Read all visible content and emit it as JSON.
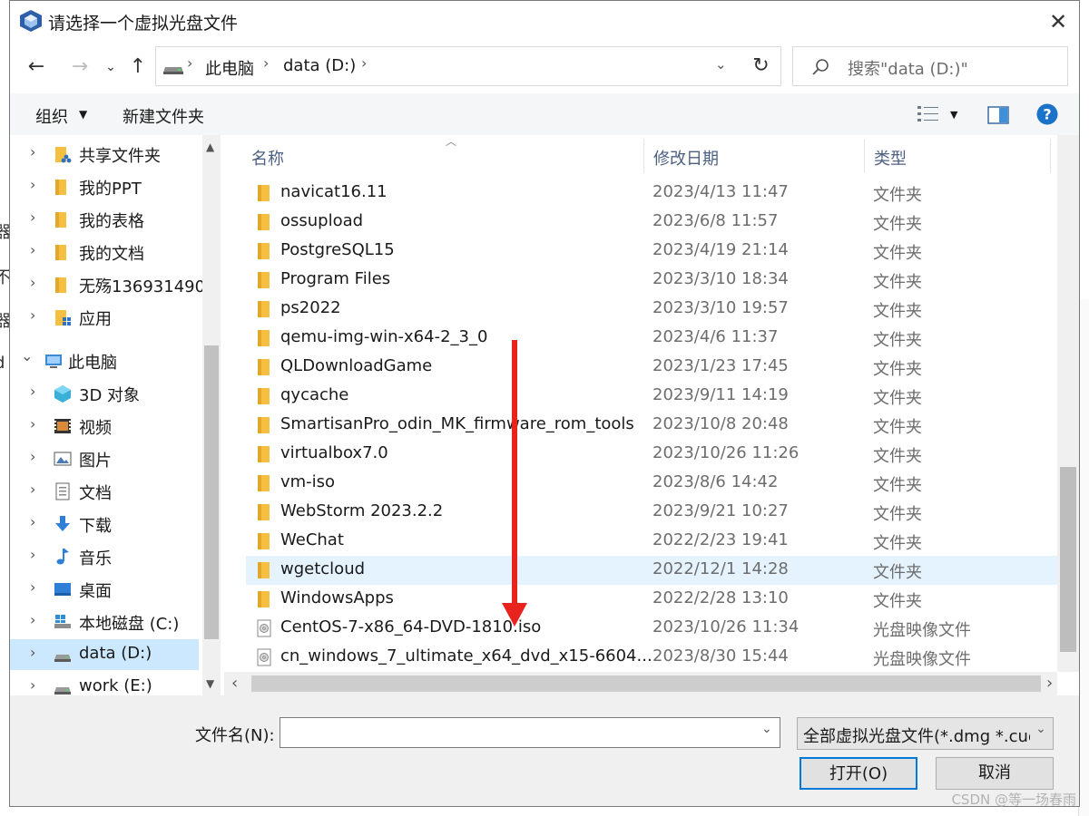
{
  "title": "请选择一个虚拟光盘文件",
  "breadcrumb": [
    "此电脑",
    "data (D:)"
  ],
  "search": {
    "placeholder": "搜索\"data (D:)\""
  },
  "toolbar": {
    "organize": "组织",
    "new_folder": "新建文件夹"
  },
  "nav_tree": [
    {
      "label": "共享文件夹",
      "icon": "shared-folder-icon"
    },
    {
      "label": "我的PPT",
      "icon": "folder-icon"
    },
    {
      "label": "我的表格",
      "icon": "folder-icon"
    },
    {
      "label": "我的文档",
      "icon": "folder-icon"
    },
    {
      "label": "无殇136931490",
      "icon": "folder-icon"
    },
    {
      "label": "应用",
      "icon": "apps-folder-icon"
    },
    {
      "label": "此电脑",
      "icon": "this-pc-icon",
      "expanded": true
    },
    {
      "label": "3D 对象",
      "icon": "3d-objects-icon"
    },
    {
      "label": "视频",
      "icon": "videos-icon"
    },
    {
      "label": "图片",
      "icon": "pictures-icon"
    },
    {
      "label": "文档",
      "icon": "documents-icon"
    },
    {
      "label": "下载",
      "icon": "downloads-icon"
    },
    {
      "label": "音乐",
      "icon": "music-icon"
    },
    {
      "label": "桌面",
      "icon": "desktop-icon"
    },
    {
      "label": "本地磁盘 (C:)",
      "icon": "system-drive-icon"
    },
    {
      "label": "data (D:)",
      "icon": "drive-icon",
      "selected": true
    },
    {
      "label": "work (E:)",
      "icon": "drive-icon"
    }
  ],
  "columns": {
    "name": "名称",
    "date": "修改日期",
    "type": "类型"
  },
  "files": [
    {
      "name": "navicat16.11",
      "date": "2023/4/13 11:47",
      "type": "文件夹",
      "kind": "folder"
    },
    {
      "name": "ossupload",
      "date": "2023/6/8 11:57",
      "type": "文件夹",
      "kind": "folder"
    },
    {
      "name": "PostgreSQL15",
      "date": "2023/4/19 21:14",
      "type": "文件夹",
      "kind": "folder"
    },
    {
      "name": "Program Files",
      "date": "2023/3/10 18:34",
      "type": "文件夹",
      "kind": "folder"
    },
    {
      "name": "ps2022",
      "date": "2023/3/10 19:57",
      "type": "文件夹",
      "kind": "folder"
    },
    {
      "name": "qemu-img-win-x64-2_3_0",
      "date": "2023/4/6 11:37",
      "type": "文件夹",
      "kind": "folder"
    },
    {
      "name": "QLDownloadGame",
      "date": "2023/1/23 17:45",
      "type": "文件夹",
      "kind": "folder"
    },
    {
      "name": "qycache",
      "date": "2023/9/11 14:19",
      "type": "文件夹",
      "kind": "folder"
    },
    {
      "name": "SmartisanPro_odin_MK_firmware_rom_tools",
      "date": "2023/10/8 20:48",
      "type": "文件夹",
      "kind": "folder"
    },
    {
      "name": "virtualbox7.0",
      "date": "2023/10/26 11:26",
      "type": "文件夹",
      "kind": "folder"
    },
    {
      "name": "vm-iso",
      "date": "2023/8/6 14:42",
      "type": "文件夹",
      "kind": "folder"
    },
    {
      "name": "WebStorm 2023.2.2",
      "date": "2023/9/21 10:27",
      "type": "文件夹",
      "kind": "folder"
    },
    {
      "name": "WeChat",
      "date": "2022/2/23 19:41",
      "type": "文件夹",
      "kind": "folder"
    },
    {
      "name": "wgetcloud",
      "date": "2022/12/1 14:28",
      "type": "文件夹",
      "kind": "folder",
      "hovered": true
    },
    {
      "name": "WindowsApps",
      "date": "2022/2/28 13:10",
      "type": "文件夹",
      "kind": "folder"
    },
    {
      "name": "CentOS-7-x86_64-DVD-1810.iso",
      "date": "2023/10/26 11:34",
      "type": "光盘映像文件",
      "kind": "disc"
    },
    {
      "name": "cn_windows_7_ultimate_x64_dvd_x15-6604...",
      "date": "2023/8/30 15:44",
      "type": "光盘映像文件",
      "kind": "disc"
    }
  ],
  "filename": {
    "label": "文件名(N):",
    "value": ""
  },
  "filter": {
    "value": "全部虚拟光盘文件(*.dmg *.cue"
  },
  "buttons": {
    "open": "打开(O)",
    "cancel": "取消"
  },
  "watermark": "CSDN @等一场春雨",
  "background_fragments": [
    ")",
    "器",
    "不",
    "器",
    "d"
  ],
  "colors": {
    "selection": "#cce8ff",
    "hover": "#e5f3ff",
    "folder": "#f5c042",
    "annotation_arrow": "#e8221c",
    "help": "#1a73c9"
  }
}
